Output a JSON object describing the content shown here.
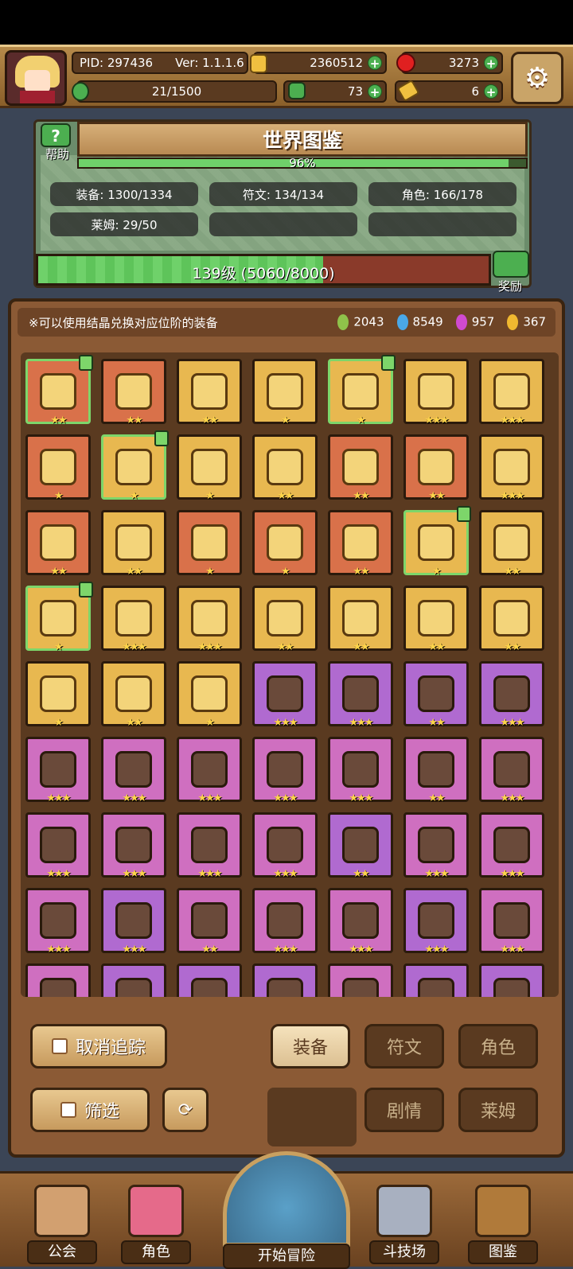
{
  "header": {
    "pid": "PID: 297436",
    "version": "Ver: 1.1.1.6",
    "gold": "2360512",
    "ruby": "3273",
    "stamina": "21/1500",
    "clover": "73",
    "key": "6"
  },
  "codex": {
    "title": "世界图鉴",
    "help_label": "帮助",
    "completion": "96%",
    "completion_fraction": 0.96,
    "stats": {
      "equipment": "装备: 1300/1334",
      "rune": "符文: 134/134",
      "character": "角色: 166/178",
      "slime": "莱姆: 29/50"
    },
    "level_text": "139级 (5060/8000)",
    "level_fraction": 0.6325,
    "reward_label": "奖励"
  },
  "panel": {
    "hint": "※可以使用结晶兑换对应位阶的装备",
    "crystals": [
      {
        "color": "#8fc24a",
        "count": "2043"
      },
      {
        "color": "#4aa8e8",
        "count": "8549"
      },
      {
        "color": "#d04ad0",
        "count": "957"
      },
      {
        "color": "#f0b830",
        "count": "367"
      }
    ]
  },
  "grid": {
    "rows": [
      [
        {
          "bg": "red",
          "stars": "★★",
          "thumb": true
        },
        {
          "bg": "red",
          "stars": "★★"
        },
        {
          "bg": "gold",
          "stars": "★★"
        },
        {
          "bg": "gold",
          "stars": "★"
        },
        {
          "bg": "gold",
          "stars": "★",
          "thumb": true
        },
        {
          "bg": "gold",
          "stars": "★★★"
        },
        {
          "bg": "gold",
          "stars": "★★★"
        }
      ],
      [
        {
          "bg": "red",
          "stars": "★"
        },
        {
          "bg": "gold",
          "stars": "★",
          "thumb": true
        },
        {
          "bg": "gold",
          "stars": "★"
        },
        {
          "bg": "gold",
          "stars": "★★"
        },
        {
          "bg": "red",
          "stars": "★★"
        },
        {
          "bg": "red",
          "stars": "★★"
        },
        {
          "bg": "gold",
          "stars": "★★★"
        }
      ],
      [
        {
          "bg": "red",
          "stars": "★★"
        },
        {
          "bg": "gold",
          "stars": "★★"
        },
        {
          "bg": "red",
          "stars": "★"
        },
        {
          "bg": "red",
          "stars": "★"
        },
        {
          "bg": "red",
          "stars": "★★"
        },
        {
          "bg": "gold",
          "stars": "★",
          "thumb": true
        },
        {
          "bg": "gold",
          "stars": "★★"
        }
      ],
      [
        {
          "bg": "gold",
          "stars": "★",
          "thumb": true
        },
        {
          "bg": "gold",
          "stars": "★★★"
        },
        {
          "bg": "gold",
          "stars": "★★★"
        },
        {
          "bg": "gold",
          "stars": "★★"
        },
        {
          "bg": "gold",
          "stars": "★★"
        },
        {
          "bg": "gold",
          "stars": "★★"
        },
        {
          "bg": "gold",
          "stars": "★★"
        }
      ],
      [
        {
          "bg": "gold",
          "stars": "★"
        },
        {
          "bg": "gold",
          "stars": "★★"
        },
        {
          "bg": "gold",
          "stars": "★"
        },
        {
          "bg": "purple",
          "stars": "★★★"
        },
        {
          "bg": "purple",
          "stars": "★★★"
        },
        {
          "bg": "purple",
          "stars": "★★"
        },
        {
          "bg": "purple",
          "stars": "★★★"
        }
      ],
      [
        {
          "bg": "pink",
          "stars": "★★★"
        },
        {
          "bg": "pink",
          "stars": "★★★"
        },
        {
          "bg": "pink",
          "stars": "★★★"
        },
        {
          "bg": "pink",
          "stars": "★★★"
        },
        {
          "bg": "pink",
          "stars": "★★★"
        },
        {
          "bg": "pink",
          "stars": "★★"
        },
        {
          "bg": "pink",
          "stars": "★★★"
        }
      ],
      [
        {
          "bg": "pink",
          "stars": "★★★"
        },
        {
          "bg": "pink",
          "stars": "★★★"
        },
        {
          "bg": "pink",
          "stars": "★★★"
        },
        {
          "bg": "pink",
          "stars": "★★★"
        },
        {
          "bg": "purple",
          "stars": "★★"
        },
        {
          "bg": "pink",
          "stars": "★★★"
        },
        {
          "bg": "pink",
          "stars": "★★★"
        }
      ],
      [
        {
          "bg": "pink",
          "stars": "★★★"
        },
        {
          "bg": "purple",
          "stars": "★★★"
        },
        {
          "bg": "pink",
          "stars": "★★"
        },
        {
          "bg": "pink",
          "stars": "★★★"
        },
        {
          "bg": "pink",
          "stars": "★★★"
        },
        {
          "bg": "purple",
          "stars": "★★★"
        },
        {
          "bg": "pink",
          "stars": "★★★"
        }
      ],
      [
        {
          "bg": "pink",
          "stars": ""
        },
        {
          "bg": "purple",
          "stars": ""
        },
        {
          "bg": "purple",
          "stars": ""
        },
        {
          "bg": "purple",
          "stars": ""
        },
        {
          "bg": "pink",
          "stars": ""
        },
        {
          "bg": "purple",
          "stars": ""
        },
        {
          "bg": "purple",
          "stars": ""
        }
      ]
    ]
  },
  "buttons": {
    "untrack": "取消追踪",
    "filter": "筛选",
    "equipment": "装备",
    "rune": "符文",
    "character": "角色",
    "story": "剧情",
    "slime": "莱姆"
  },
  "nav": {
    "guild": "公会",
    "character": "角色",
    "adventure": "开始冒险",
    "arena": "斗技场",
    "codex": "图鉴"
  }
}
